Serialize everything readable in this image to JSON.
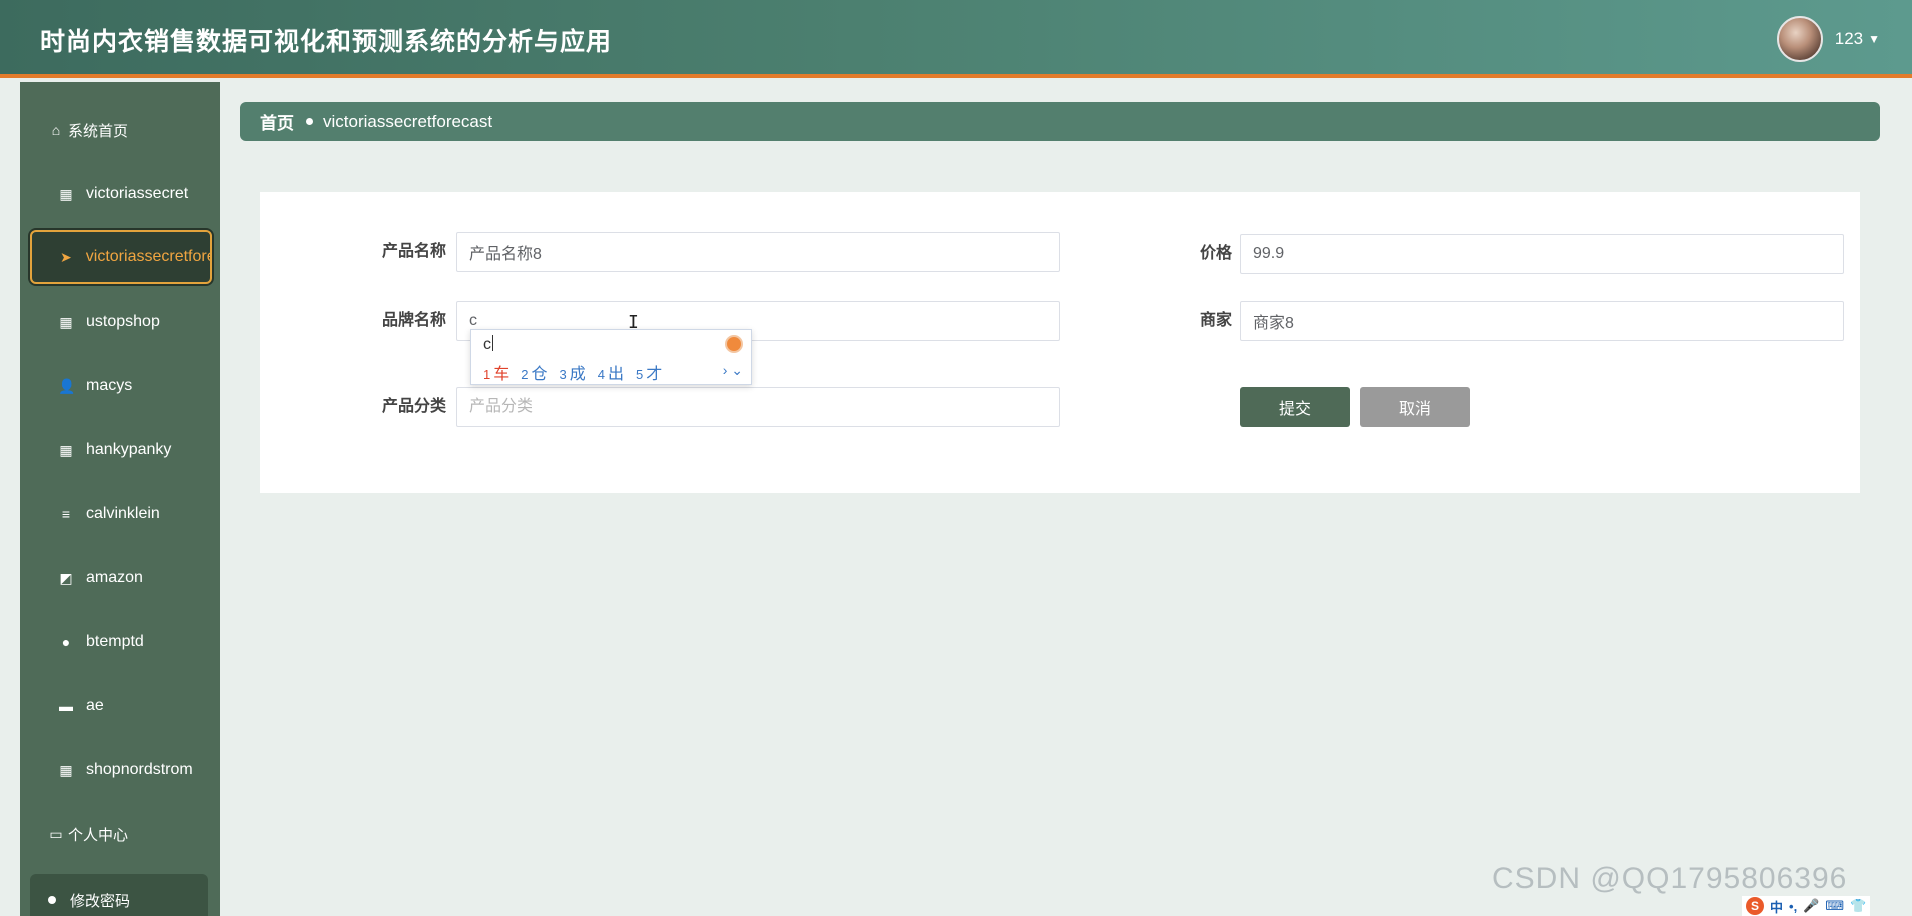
{
  "header": {
    "title": "时尚内衣销售数据可视化和预测系统的分析与应用",
    "username": "123"
  },
  "sidebar": {
    "home": "系统首页",
    "items": [
      {
        "label": "victoriassecret",
        "icon": "grid-icon"
      },
      {
        "label": "victoriassecretforecast",
        "icon": "paper-plane-icon"
      },
      {
        "label": "ustopshop",
        "icon": "grid-icon"
      },
      {
        "label": "macys",
        "icon": "user-icon"
      },
      {
        "label": "hankypanky",
        "icon": "grid-icon"
      },
      {
        "label": "calvinklein",
        "icon": "list-icon"
      },
      {
        "label": "amazon",
        "icon": "chart-icon"
      },
      {
        "label": "btemptd",
        "icon": "bulb-icon"
      },
      {
        "label": "ae",
        "icon": "message-icon"
      },
      {
        "label": "shopnordstrom",
        "icon": "grid-icon"
      }
    ],
    "personal": "个人中心",
    "change_password": "修改密码"
  },
  "breadcrumb": {
    "home": "首页",
    "current": "victoriassecretforecast"
  },
  "form": {
    "product_name": {
      "label": "产品名称",
      "value": "产品名称8"
    },
    "price": {
      "label": "价格",
      "value": "99.9"
    },
    "brand_name": {
      "label": "品牌名称",
      "value": "c"
    },
    "merchant": {
      "label": "商家",
      "value": "商家8"
    },
    "category": {
      "label": "产品分类",
      "placeholder": "产品分类",
      "value": ""
    },
    "submit_label": "提交",
    "cancel_label": "取消"
  },
  "ime": {
    "typed": "c",
    "candidates": [
      {
        "n": "1",
        "c": "车"
      },
      {
        "n": "2",
        "c": "仓"
      },
      {
        "n": "3",
        "c": "成"
      },
      {
        "n": "4",
        "c": "出"
      },
      {
        "n": "5",
        "c": "才"
      }
    ],
    "nav": "› ⌄"
  },
  "watermark": "CSDN @QQ1795806396",
  "tray": {
    "lang": "中",
    "punct": "•,"
  },
  "colors": {
    "header": "#4c8070",
    "header_border": "#e37b2b",
    "sidebar": "#4f6b58",
    "active_accent": "#f0a541",
    "submit": "#4f6a57",
    "cancel": "#9a9a9a"
  }
}
